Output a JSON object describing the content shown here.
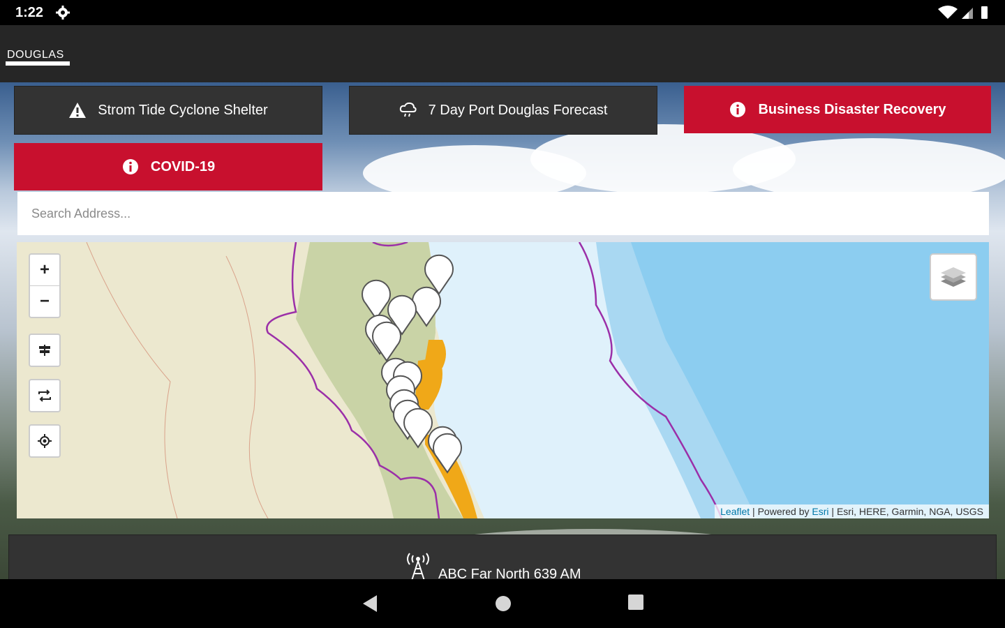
{
  "status_bar": {
    "time": "1:22"
  },
  "app": {
    "logo_text": "DOUGLAS"
  },
  "quick_links": [
    {
      "label": "Strom Tide Cyclone Shelter",
      "icon": "warning-triangle-icon",
      "style": "dark"
    },
    {
      "label": "7 Day Port Douglas Forecast",
      "icon": "cloud-rain-icon",
      "style": "dark"
    },
    {
      "label": "Business Disaster Recovery",
      "icon": "info-circle-icon",
      "style": "red"
    },
    {
      "label": "COVID-19",
      "icon": "info-circle-icon",
      "style": "red"
    }
  ],
  "search": {
    "placeholder": "Search Address..."
  },
  "map": {
    "controls": [
      "zoom-in",
      "zoom-out",
      "legend",
      "toggle",
      "locate"
    ],
    "zoom_in_label": "+",
    "zoom_out_label": "−",
    "attribution": {
      "leaflet": "Leaflet",
      "powered": " | Powered by ",
      "esri": "Esri",
      "rest": " | Esri, HERE, Garmin, NGA, USGS"
    }
  },
  "radio": {
    "label": "ABC Far North 639 AM",
    "icon": "radio-tower-icon"
  },
  "colors": {
    "accent_red": "#c8102e",
    "dark_button": "#333333",
    "appbar": "#262626",
    "boundary_purple": "#9b2fa8",
    "flood_orange": "#f0a818"
  }
}
